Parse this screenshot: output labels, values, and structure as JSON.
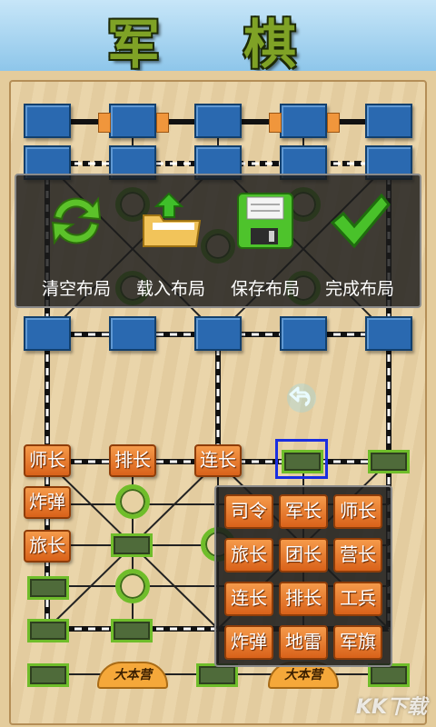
{
  "app": {
    "title": "军 棋"
  },
  "toolbar": {
    "items": [
      {
        "label": "清空布局",
        "icon": "refresh-icon"
      },
      {
        "label": "载入布局",
        "icon": "folder-upload-icon"
      },
      {
        "label": "保存布局",
        "icon": "floppy-disk-icon"
      },
      {
        "label": "完成布局",
        "icon": "checkmark-icon"
      }
    ]
  },
  "board": {
    "headquarters_label": "大本营",
    "placed_pieces": [
      {
        "label": "师长"
      },
      {
        "label": "排长"
      },
      {
        "label": "连长"
      },
      {
        "label": "炸弹"
      },
      {
        "label": "旅长"
      }
    ]
  },
  "picker": {
    "pieces": [
      "司令",
      "军长",
      "师长",
      "旅长",
      "团长",
      "营长",
      "连长",
      "排长",
      "工兵",
      "炸弹",
      "地雷",
      "军旗"
    ]
  },
  "watermark": "KK下载",
  "colors": {
    "piece": "#e8772a",
    "post_blue": "#2a69b0",
    "post_green": "#6fbd2a",
    "select_frame": "#1a2ee0"
  }
}
